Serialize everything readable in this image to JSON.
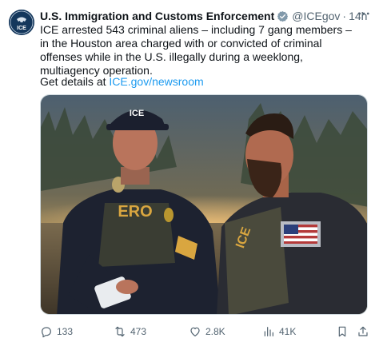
{
  "tweet": {
    "author_name": "U.S. Immigration and Customs Enforcement",
    "handle": "@ICEgov",
    "separator": "·",
    "time": "14h",
    "avatar_text": "ICE",
    "body": "ICE arrested 543 criminal aliens – including 7 gang members – in the Houston area charged with or convicted of criminal offenses while in the U.S. illegally during a weeklong, multiagency operation.",
    "details_prefix": "Get details at ",
    "details_link": "ICE.gov/newsroom"
  },
  "media": {
    "cap_text": "ICE",
    "vest_text": "ERO",
    "vest_text_2": "ICE"
  },
  "actions": {
    "replies": "133",
    "reposts": "473",
    "likes": "2.8K",
    "views": "41K"
  },
  "colors": {
    "text": "#0f1419",
    "muted": "#536471",
    "link": "#1d9bf0",
    "verified": "#829aab"
  }
}
